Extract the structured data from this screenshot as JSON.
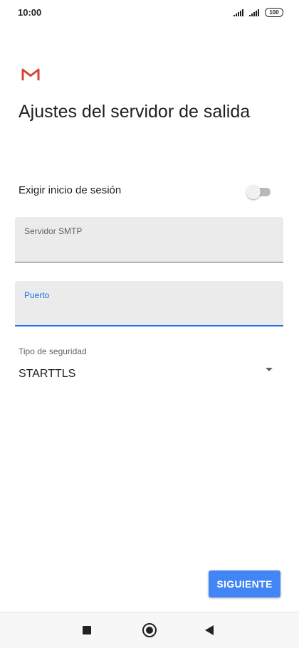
{
  "status_bar": {
    "time": "10:00",
    "battery": "100",
    "icons": [
      "signal-icon",
      "signal-icon",
      "battery-icon"
    ]
  },
  "app": {
    "logo": "gmail-logo"
  },
  "page": {
    "title": "Ajustes del servidor de salida"
  },
  "login_toggle": {
    "label": "Exigir inicio de sesión",
    "enabled": false
  },
  "smtp_field": {
    "label": "Servidor SMTP",
    "value": ""
  },
  "port_field": {
    "label": "Puerto",
    "value": "",
    "focused": true
  },
  "security": {
    "label": "Tipo de seguridad",
    "selected": "STARTTLS"
  },
  "actions": {
    "next_label": "SIGUIENTE"
  },
  "colors": {
    "accent": "#4285f4",
    "focus": "#1a73e8",
    "field_bg": "#ebebeb",
    "gmail_red": "#d44638"
  },
  "nav_bar": {
    "icons": [
      "recents-icon",
      "home-icon",
      "back-icon"
    ]
  }
}
